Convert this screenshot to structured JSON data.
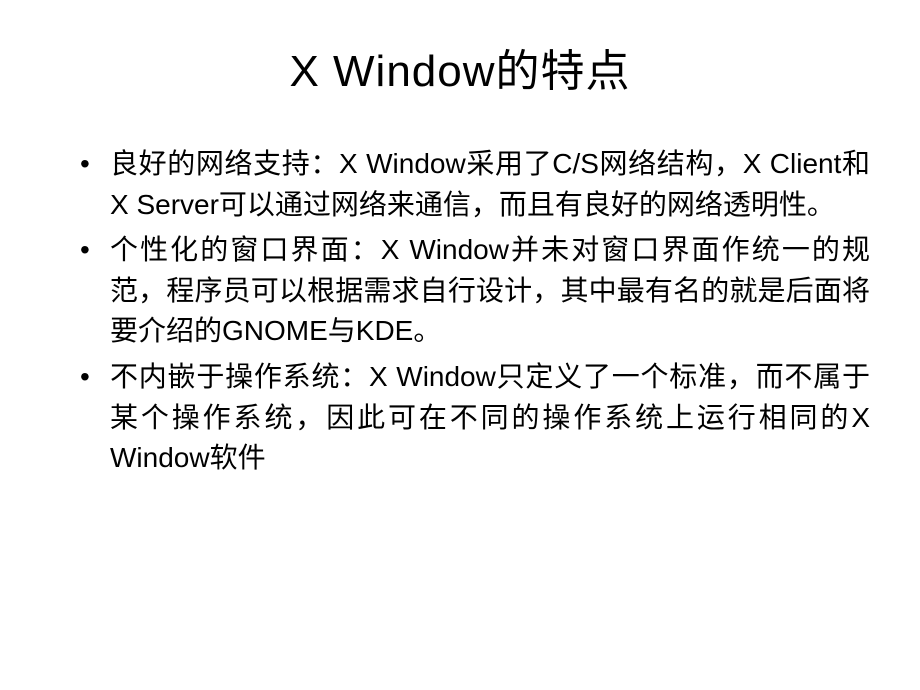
{
  "slide": {
    "title": "X Window的特点",
    "bullets": [
      "良好的网络支持：X Window采用了C/S网络结构，X Client和X Server可以通过网络来通信，而且有良好的网络透明性。",
      "个性化的窗口界面：X Window并未对窗口界面作统一的规范，程序员可以根据需求自行设计，其中最有名的就是后面将要介绍的GNOME与KDE。",
      "不内嵌于操作系统：X Window只定义了一个标准，而不属于某个操作系统，因此可在不同的操作系统上运行相同的X Window软件"
    ]
  }
}
